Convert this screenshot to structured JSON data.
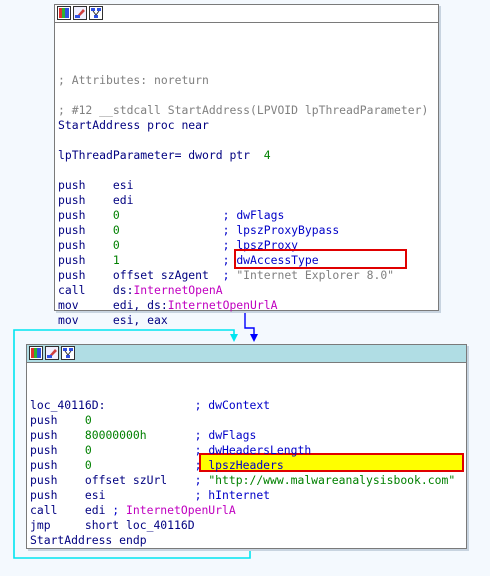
{
  "node1": {
    "lines": [
      {
        "segs": [
          [
            "; Attributes: noreturn",
            "c-gry"
          ]
        ]
      },
      {
        "segs": [
          [
            "; #12 __stdcall StartAddress(LPVOID lpThreadParameter)",
            "c-gry"
          ]
        ]
      },
      {
        "segs": [
          [
            "StartAddress proc near",
            "c-blk"
          ]
        ]
      },
      {
        "segs": [
          [
            "lpThreadParameter= dword ptr  ",
            "c-blk"
          ],
          [
            "4",
            "c-grn"
          ]
        ]
      },
      {
        "segs": [
          [
            "push    esi",
            "c-blk"
          ]
        ]
      },
      {
        "segs": [
          [
            "push    edi",
            "c-blk"
          ]
        ]
      },
      {
        "segs": [
          [
            "push    ",
            "c-blk"
          ],
          [
            "0",
            "c-grn"
          ],
          [
            "               ",
            "c-blk"
          ],
          [
            "; dwFlags",
            "c-cmt"
          ]
        ]
      },
      {
        "segs": [
          [
            "push    ",
            "c-blk"
          ],
          [
            "0",
            "c-grn"
          ],
          [
            "               ",
            "c-blk"
          ],
          [
            "; lpszProxyBypass",
            "c-cmt"
          ]
        ]
      },
      {
        "segs": [
          [
            "push    ",
            "c-blk"
          ],
          [
            "0",
            "c-grn"
          ],
          [
            "               ",
            "c-blk"
          ],
          [
            "; lpszProxy",
            "c-cmt"
          ]
        ]
      },
      {
        "segs": [
          [
            "push    ",
            "c-blk"
          ],
          [
            "1",
            "c-grn"
          ],
          [
            "               ",
            "c-blk"
          ],
          [
            "; dwAccessType",
            "c-cmt"
          ]
        ]
      },
      {
        "segs": [
          [
            "push    offset szAgent  ",
            "c-blk"
          ],
          [
            "; ",
            "c-cmt"
          ],
          [
            "\"Internet Explorer 8.0\"",
            "c-gry"
          ]
        ]
      },
      {
        "segs": [
          [
            "call    ds:",
            "c-blk"
          ],
          [
            "InternetOpenA",
            "c-mag"
          ]
        ]
      },
      {
        "segs": [
          [
            "mov     edi, ds:",
            "c-blk"
          ],
          [
            "InternetOpenUrlA",
            "c-mag"
          ]
        ]
      },
      {
        "segs": [
          [
            "mov     esi, eax",
            "c-blk"
          ]
        ]
      }
    ]
  },
  "node2": {
    "lines": [
      {
        "segs": [
          [
            "loc_40116D:             ",
            "c-blk"
          ],
          [
            "; dwContext",
            "c-cmt"
          ]
        ]
      },
      {
        "segs": [
          [
            "push    ",
            "c-blk"
          ],
          [
            "0",
            "c-grn"
          ]
        ]
      },
      {
        "segs": [
          [
            "push    ",
            "c-blk"
          ],
          [
            "80000000h",
            "c-grn"
          ],
          [
            "       ",
            "c-blk"
          ],
          [
            "; dwFlags",
            "c-cmt"
          ]
        ]
      },
      {
        "segs": [
          [
            "push    ",
            "c-blk"
          ],
          [
            "0",
            "c-grn"
          ],
          [
            "               ",
            "c-blk"
          ],
          [
            "; dwHeadersLength",
            "c-cmt"
          ]
        ]
      },
      {
        "segs": [
          [
            "push    ",
            "c-blk"
          ],
          [
            "0",
            "c-grn"
          ],
          [
            "               ",
            "c-blk"
          ],
          [
            "; lpszHeaders",
            "c-cmt"
          ]
        ]
      },
      {
        "segs": [
          [
            "push    offset szUrl    ",
            "c-blk"
          ],
          [
            "; ",
            "c-cmt"
          ],
          [
            "\"http://www.malwareanalysisbook.com\"",
            "c-str"
          ]
        ]
      },
      {
        "segs": [
          [
            "push    esi             ",
            "c-blk"
          ],
          [
            "; hInternet",
            "c-cmt"
          ]
        ]
      },
      {
        "segs": [
          [
            "call    edi ",
            "c-blk"
          ],
          [
            "; ",
            "c-cmt"
          ],
          [
            "InternetOpenUrlA",
            "c-mag"
          ]
        ]
      },
      {
        "segs": [
          [
            "jmp     short loc_40116D",
            "c-blk"
          ]
        ]
      },
      {
        "segs": [
          [
            "StartAddress endp",
            "c-blk"
          ]
        ]
      }
    ]
  },
  "colors": {
    "edge_blue": "#0000ff",
    "edge_cyan": "#00e5f0",
    "highlight": "#e00000"
  },
  "icons": [
    "graph-color-icon",
    "rename-node-icon",
    "grouped-nodes-icon"
  ]
}
